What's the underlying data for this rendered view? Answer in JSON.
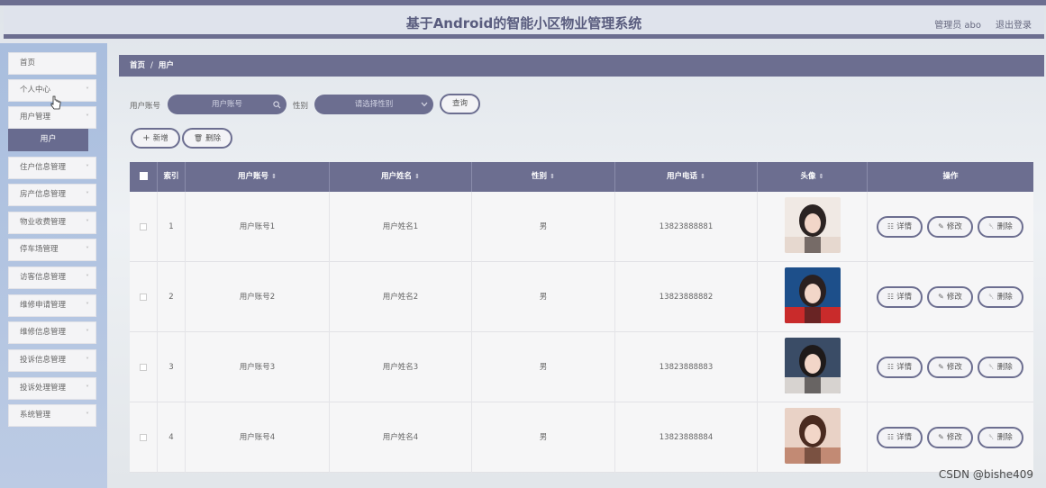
{
  "header": {
    "title": "基于Android的智能小区物业管理系统",
    "user": "管理员 abo",
    "logout": "退出登录"
  },
  "sidebar": {
    "items": [
      {
        "label": "首页",
        "chevron": false
      },
      {
        "label": "个人中心",
        "chevron": true
      },
      {
        "label": "用户管理",
        "chevron": true
      },
      {
        "label": "住户信息管理",
        "chevron": true
      },
      {
        "label": "房产信息管理",
        "chevron": true
      },
      {
        "label": "物业收费管理",
        "chevron": true
      },
      {
        "label": "停车场管理",
        "chevron": true
      },
      {
        "label": "访客信息管理",
        "chevron": true
      },
      {
        "label": "维修申请管理",
        "chevron": true
      },
      {
        "label": "维修信息管理",
        "chevron": true
      },
      {
        "label": "投诉信息管理",
        "chevron": true
      },
      {
        "label": "投诉处理管理",
        "chevron": true
      },
      {
        "label": "系统管理",
        "chevron": true
      }
    ],
    "active_sub": "用户"
  },
  "breadcrumb": {
    "home": "首页",
    "sep": "/",
    "current": "用户"
  },
  "search": {
    "account_label": "用户账号",
    "account_placeholder": "用户账号",
    "gender_label": "性别",
    "gender_placeholder": "请选择性别",
    "query": "查询"
  },
  "toolbar": {
    "add": "新增",
    "delete": "删除"
  },
  "table": {
    "headers": {
      "index": "索引",
      "account": "用户账号",
      "name": "用户姓名",
      "gender": "性别",
      "phone": "用户电话",
      "avatar": "头像",
      "ops": "操作"
    },
    "rows": [
      {
        "index": "1",
        "account": "用户账号1",
        "name": "用户姓名1",
        "gender": "男",
        "phone": "13823888881"
      },
      {
        "index": "2",
        "account": "用户账号2",
        "name": "用户姓名2",
        "gender": "男",
        "phone": "13823888882"
      },
      {
        "index": "3",
        "account": "用户账号3",
        "name": "用户姓名3",
        "gender": "男",
        "phone": "13823888883"
      },
      {
        "index": "4",
        "account": "用户账号4",
        "name": "用户姓名4",
        "gender": "男",
        "phone": "13823888884"
      }
    ],
    "op_labels": {
      "detail": "详情",
      "edit": "修改",
      "delete": "删除"
    }
  },
  "watermark": "CSDN @bishe409",
  "colors": {
    "primary": "#6c6e90",
    "sidebar": "#b2c4e0"
  }
}
